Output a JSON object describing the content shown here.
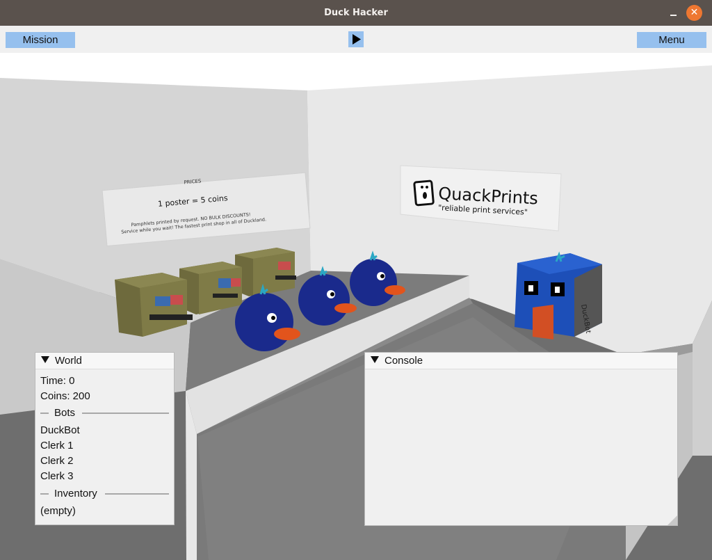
{
  "window": {
    "title": "Duck Hacker",
    "minimize_icon": "minimize-icon",
    "close_icon": "close-icon",
    "close_glyph": "✕"
  },
  "toolbar": {
    "mission_label": "Mission",
    "menu_label": "Menu",
    "play_icon": "play-icon"
  },
  "scene": {
    "prices_sign": {
      "heading": "PRICES",
      "main": "1 poster = 5 coins",
      "line1": "Pamphlets printed by request. NO BULK DISCOUNTS!",
      "line2": "Service while you wait! The fastest print shop in all of Duckland."
    },
    "shop_sign": {
      "name": "QuackPrints",
      "tagline": "\"reliable print services\""
    },
    "duckbot_label": "DuckBot"
  },
  "world_panel": {
    "title": "World",
    "time": "Time: 0",
    "coins": "Coins: 200",
    "bots_header": "Bots",
    "bots": [
      "DuckBot",
      "Clerk 1",
      "Clerk 2",
      "Clerk 3"
    ],
    "inventory_header": "Inventory",
    "inventory": "(empty)"
  },
  "console_panel": {
    "title": "Console"
  },
  "colors": {
    "titlebar": "#5a524d",
    "button": "#96c0ee",
    "close": "#ee7731",
    "duck_blue": "#1a2a8c",
    "beak": "#e2541c",
    "printer": "#7f7b47"
  }
}
